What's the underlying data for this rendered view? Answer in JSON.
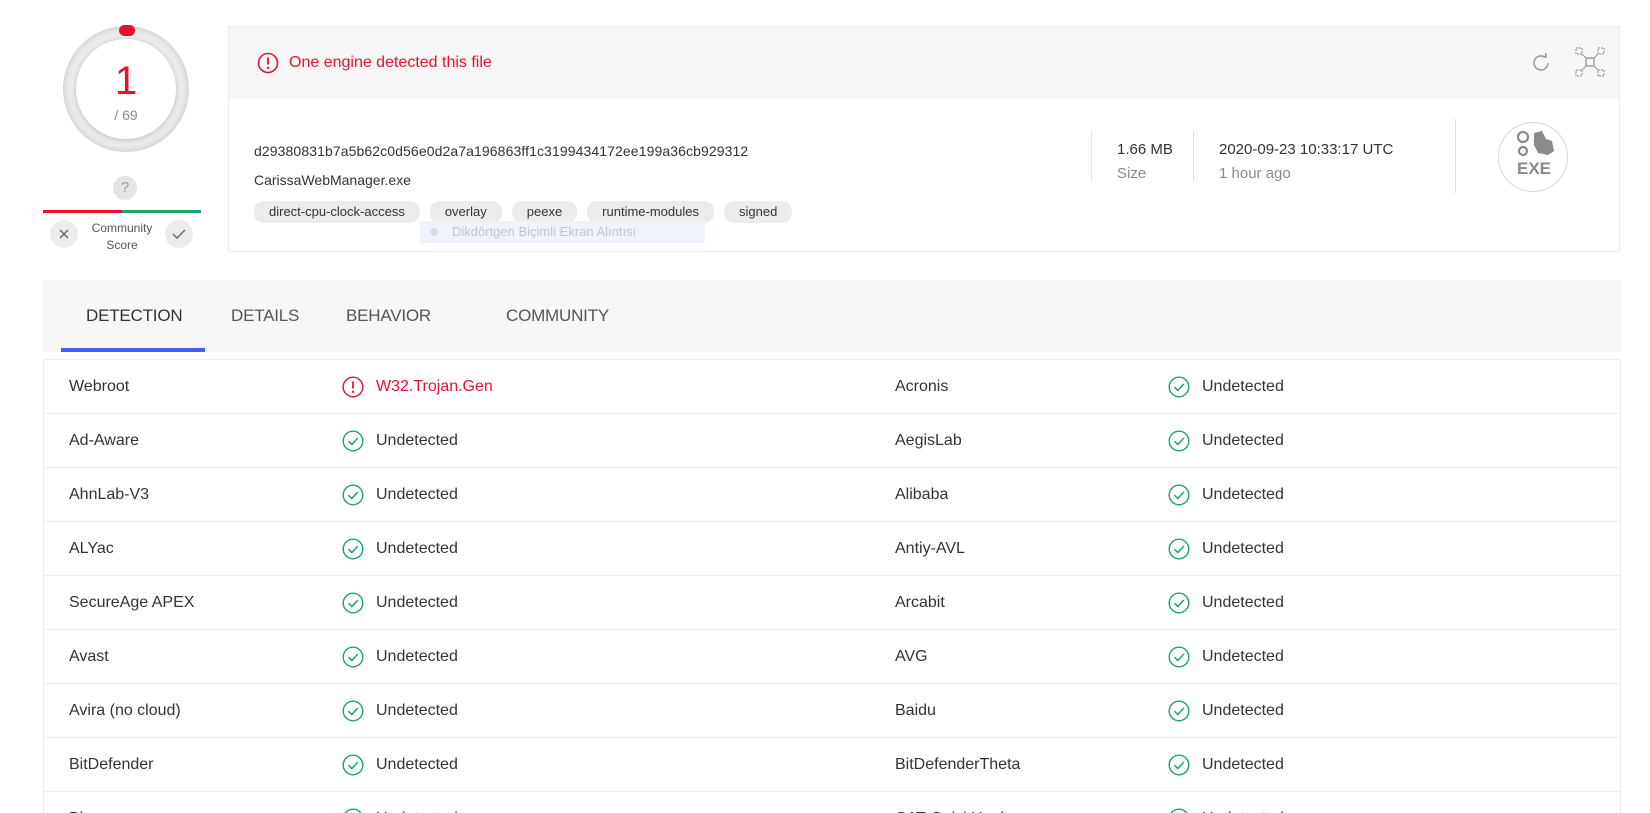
{
  "score": {
    "detections": "1",
    "total": "/ 69",
    "community_label": "Community\nScore",
    "unknown_mark": "?"
  },
  "alert": {
    "text": "One engine detected this file"
  },
  "file": {
    "hash": "d29380831b7a5b62c0d56e0d2a7a196863ff1c3199434172ee199a36cb929312",
    "name": "CarissaWebManager.exe",
    "tags": [
      "direct-cpu-clock-access",
      "overlay",
      "peexe",
      "runtime-modules",
      "signed"
    ],
    "size_value": "1.66 MB",
    "size_label": "Size",
    "date_value": "2020-09-23 10:33:17 UTC",
    "date_ago": "1 hour ago",
    "type_badge": "EXE"
  },
  "overlay_ghost": "Dikdörtgen Biçimli Ekran Alıntısı",
  "tabs": [
    "DETECTION",
    "DETAILS",
    "BEHAVIOR",
    "COMMUNITY"
  ],
  "active_tab": "DETECTION",
  "colors": {
    "danger": "#e8102f",
    "success": "#1fa463",
    "accent": "#3b61f5"
  },
  "detections": [
    {
      "left": {
        "engine": "Webroot",
        "result": "W32.Trojan.Gen",
        "status": "detected"
      },
      "right": {
        "engine": "Acronis",
        "result": "Undetected",
        "status": "undetected"
      }
    },
    {
      "left": {
        "engine": "Ad-Aware",
        "result": "Undetected",
        "status": "undetected"
      },
      "right": {
        "engine": "AegisLab",
        "result": "Undetected",
        "status": "undetected"
      }
    },
    {
      "left": {
        "engine": "AhnLab-V3",
        "result": "Undetected",
        "status": "undetected"
      },
      "right": {
        "engine": "Alibaba",
        "result": "Undetected",
        "status": "undetected"
      }
    },
    {
      "left": {
        "engine": "ALYac",
        "result": "Undetected",
        "status": "undetected"
      },
      "right": {
        "engine": "Antiy-AVL",
        "result": "Undetected",
        "status": "undetected"
      }
    },
    {
      "left": {
        "engine": "SecureAge APEX",
        "result": "Undetected",
        "status": "undetected"
      },
      "right": {
        "engine": "Arcabit",
        "result": "Undetected",
        "status": "undetected"
      }
    },
    {
      "left": {
        "engine": "Avast",
        "result": "Undetected",
        "status": "undetected"
      },
      "right": {
        "engine": "AVG",
        "result": "Undetected",
        "status": "undetected"
      }
    },
    {
      "left": {
        "engine": "Avira (no cloud)",
        "result": "Undetected",
        "status": "undetected"
      },
      "right": {
        "engine": "Baidu",
        "result": "Undetected",
        "status": "undetected"
      }
    },
    {
      "left": {
        "engine": "BitDefender",
        "result": "Undetected",
        "status": "undetected"
      },
      "right": {
        "engine": "BitDefenderTheta",
        "result": "Undetected",
        "status": "undetected"
      }
    },
    {
      "left": {
        "engine": "Bkav",
        "result": "Undetected",
        "status": "undetected"
      },
      "right": {
        "engine": "CAT-QuickHeal",
        "result": "Undetected",
        "status": "undetected"
      }
    }
  ]
}
